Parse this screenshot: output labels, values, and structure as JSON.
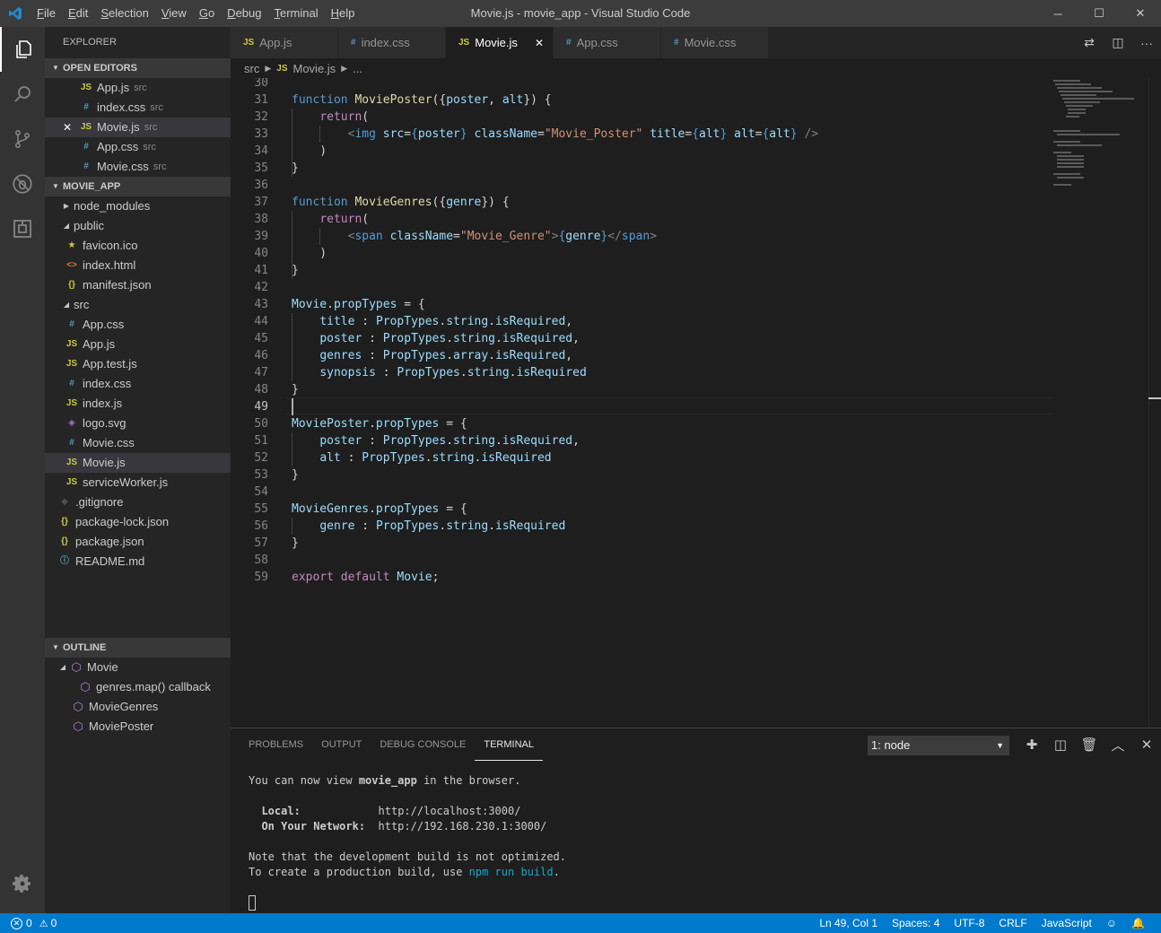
{
  "window": {
    "title": "Movie.js - movie_app - Visual Studio Code",
    "menu": [
      "File",
      "Edit",
      "Selection",
      "View",
      "Go",
      "Debug",
      "Terminal",
      "Help"
    ],
    "controls": {
      "minimize": "─",
      "maximize": "☐",
      "close": "✕"
    }
  },
  "sidebar": {
    "title": "EXPLORER",
    "open_editors": {
      "header": "OPEN EDITORS",
      "items": [
        {
          "icon": "JS",
          "name": "App.js",
          "dir": "src"
        },
        {
          "icon": "#",
          "name": "index.css",
          "dir": "src"
        },
        {
          "icon": "JS",
          "name": "Movie.js",
          "dir": "src",
          "close": "✕"
        },
        {
          "icon": "#",
          "name": "App.css",
          "dir": "src"
        },
        {
          "icon": "#",
          "name": "Movie.css",
          "dir": "src"
        }
      ]
    },
    "project": {
      "header": "MOVIE_APP",
      "folders": {
        "node_modules": "node_modules",
        "public": "public",
        "src": "src"
      },
      "public_files": [
        {
          "icon": "★",
          "name": "favicon.ico"
        },
        {
          "icon": "<>",
          "name": "index.html"
        },
        {
          "icon": "{}",
          "name": "manifest.json"
        }
      ],
      "src_files": [
        {
          "icon": "#",
          "name": "App.css"
        },
        {
          "icon": "JS",
          "name": "App.js"
        },
        {
          "icon": "JS",
          "name": "App.test.js"
        },
        {
          "icon": "#",
          "name": "index.css"
        },
        {
          "icon": "JS",
          "name": "index.js"
        },
        {
          "icon": "◈",
          "name": "logo.svg"
        },
        {
          "icon": "#",
          "name": "Movie.css"
        },
        {
          "icon": "JS",
          "name": "Movie.js"
        },
        {
          "icon": "JS",
          "name": "serviceWorker.js"
        }
      ],
      "root_files": [
        {
          "icon": "◆",
          "name": ".gitignore"
        },
        {
          "icon": "{}",
          "name": "package-lock.json"
        },
        {
          "icon": "{}",
          "name": "package.json"
        },
        {
          "icon": "ⓘ",
          "name": "README.md"
        }
      ]
    },
    "outline": {
      "header": "OUTLINE",
      "items": [
        {
          "name": "Movie"
        },
        {
          "name": "genres.map() callback"
        },
        {
          "name": "MovieGenres"
        },
        {
          "name": "MoviePoster"
        }
      ]
    }
  },
  "tabs": [
    {
      "icon": "JS",
      "label": "App.js"
    },
    {
      "icon": "#",
      "label": "index.css"
    },
    {
      "icon": "JS",
      "label": "Movie.js",
      "close": "✕"
    },
    {
      "icon": "#",
      "label": "App.css"
    },
    {
      "icon": "#",
      "label": "Movie.css"
    }
  ],
  "breadcrumb": {
    "folder": "src",
    "icon": "JS",
    "file": "Movie.js",
    "more": "..."
  },
  "editor": {
    "line_numbers": [
      "30",
      "31",
      "32",
      "33",
      "34",
      "35",
      "36",
      "37",
      "38",
      "39",
      "40",
      "41",
      "42",
      "43",
      "44",
      "45",
      "46",
      "47",
      "48",
      "49",
      "50",
      "51",
      "52",
      "53",
      "54",
      "55",
      "56",
      "57",
      "58",
      "59"
    ],
    "current_line": "49"
  },
  "panel": {
    "tabs": [
      "PROBLEMS",
      "OUTPUT",
      "DEBUG CONSOLE",
      "TERMINAL"
    ],
    "terminal_select": "1: node",
    "terminal": {
      "l1a": "You can now view ",
      "l1b": "movie_app",
      "l1c": " in the browser.",
      "local_label": "Local:",
      "local_url": "http://localhost:3000/",
      "net_label": "On Your Network:",
      "net_url": "http://192.168.230.1:3000/",
      "note": "Note that the development build is not optimized.",
      "prod_a": "To create a production build, use ",
      "prod_cmd": "npm run build",
      "prod_b": "."
    }
  },
  "statusbar": {
    "errors": "0",
    "warnings": "0",
    "position": "Ln 49, Col 1",
    "spaces": "Spaces: 4",
    "encoding": "UTF-8",
    "eol": "CRLF",
    "language": "JavaScript"
  },
  "colors": {
    "accent": "#007acc",
    "editor_bg": "#1e1e1e",
    "sidebar_bg": "#252526"
  }
}
